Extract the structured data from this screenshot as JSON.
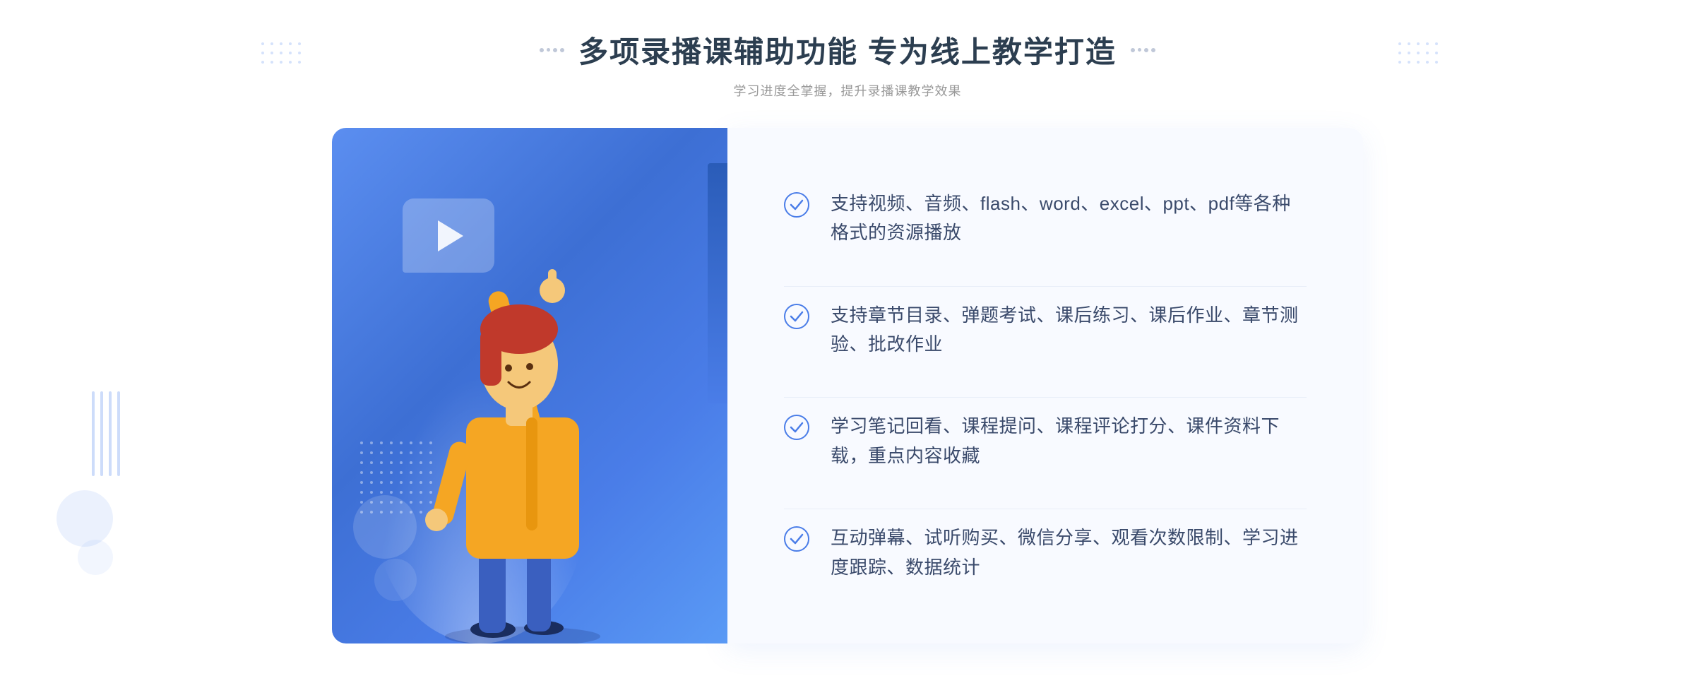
{
  "header": {
    "title": "多项录播课辅助功能 专为线上教学打造",
    "subtitle": "学习进度全掌握，提升录播课教学效果"
  },
  "features": [
    {
      "id": "feature-1",
      "text": "支持视频、音频、flash、word、excel、ppt、pdf等各种格式的资源播放"
    },
    {
      "id": "feature-2",
      "text": "支持章节目录、弹题考试、课后练习、课后作业、章节测验、批改作业"
    },
    {
      "id": "feature-3",
      "text": "学习笔记回看、课程提问、课程评论打分、课件资料下载，重点内容收藏"
    },
    {
      "id": "feature-4",
      "text": "互动弹幕、试听购买、微信分享、观看次数限制、学习进度跟踪、数据统计"
    }
  ],
  "decoration": {
    "chevron_left": "«",
    "check_color": "#4a7de8",
    "title_deco_color": "#c0c8d8"
  }
}
